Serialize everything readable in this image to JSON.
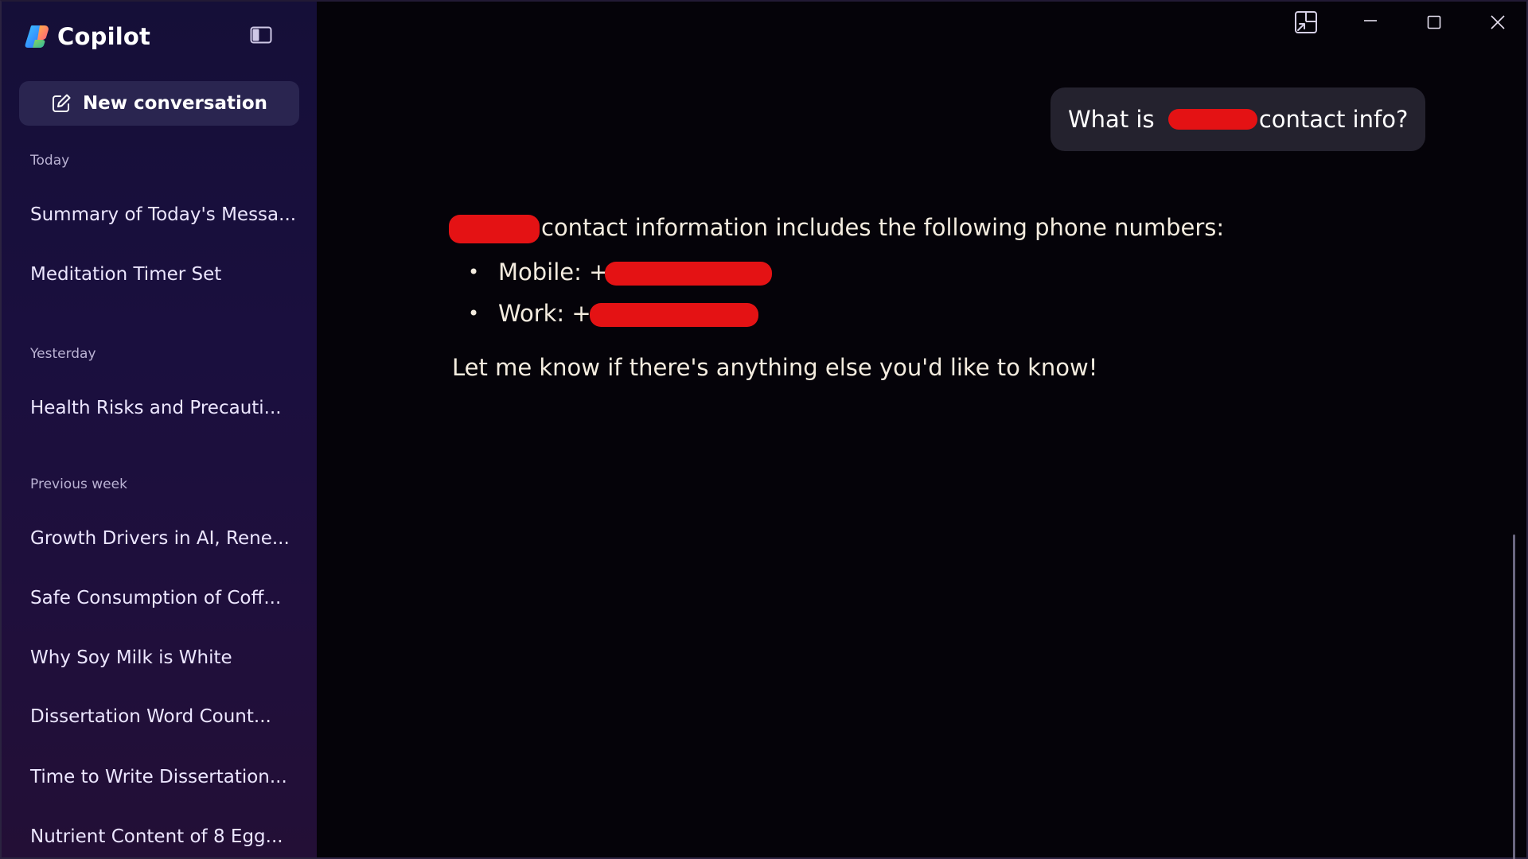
{
  "app": {
    "name": "Copilot"
  },
  "sidebar": {
    "new_conversation_label": "New conversation",
    "sections": [
      {
        "label": "Today",
        "items": [
          "Summary of Today's Messa...",
          "Meditation Timer Set"
        ]
      },
      {
        "label": "Yesterday",
        "items": [
          "Health Risks and Precauti..."
        ]
      },
      {
        "label": "Previous week",
        "items": [
          "Growth Drivers in AI, Rene...",
          "Safe Consumption of Coff...",
          "Why Soy Milk is White",
          "Dissertation Word Count...",
          "Time to Write Dissertation...",
          "Nutrient Content of 8 Egg..."
        ]
      }
    ]
  },
  "chat": {
    "user_message": {
      "prefix": "What is ",
      "suffix": "contact info?"
    },
    "assistant_message": {
      "intro": "contact information includes the following phone numbers:",
      "items": [
        {
          "label": "Mobile: +"
        },
        {
          "label": "Work: +"
        }
      ],
      "closing": "Let me know if there's anything else you'd like to know!"
    }
  },
  "icons": {
    "logo": "copilot-logo",
    "sidebar_toggle": "sidebar-toggle-icon",
    "new_conversation": "compose-icon",
    "snap": "snap-layout-icon",
    "minimize": "minimize-icon",
    "maximize": "maximize-icon",
    "close": "close-icon"
  },
  "colors": {
    "redaction": "#e41214",
    "sidebar_bg": "#1a0f3e",
    "main_bg": "#050309",
    "user_bubble": "#24222e"
  }
}
